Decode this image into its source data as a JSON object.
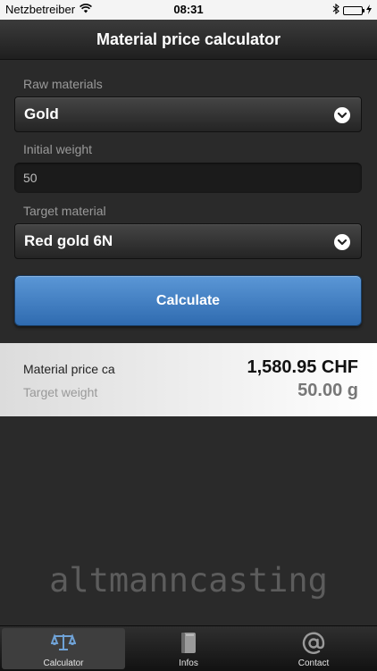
{
  "status_bar": {
    "carrier": "Netzbetreiber",
    "time": "08:31",
    "icons": [
      "wifi-icon",
      "bluetooth-icon",
      "battery-icon"
    ]
  },
  "nav": {
    "title": "Material price calculator"
  },
  "form": {
    "raw_materials_label": "Raw materials",
    "raw_materials_value": "Gold",
    "initial_weight_label": "Initial weight",
    "initial_weight_value": "50",
    "target_material_label": "Target material",
    "target_material_value": "Red gold 6N",
    "calculate_label": "Calculate"
  },
  "result": {
    "price_label": "Material price ca",
    "price_value": "1,580.95 CHF",
    "weight_label": "Target weight",
    "weight_value": "50.00 g"
  },
  "logo": {
    "text": "altmanncasting"
  },
  "tabs": [
    {
      "label": "Calculator",
      "icon": "scales-icon",
      "active": true
    },
    {
      "label": "Infos",
      "icon": "book-icon",
      "active": false
    },
    {
      "label": "Contact",
      "icon": "at-sign-icon",
      "active": false
    }
  ],
  "colors": {
    "accent": "#3f7fc4",
    "background": "#2a2a2a",
    "tab_icon": "#6fa2d6"
  }
}
